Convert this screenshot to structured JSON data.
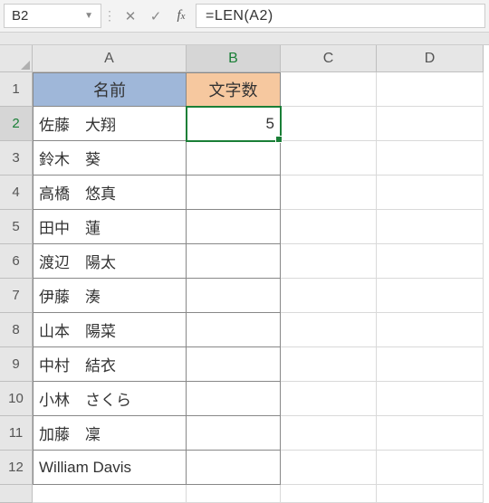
{
  "formula_bar": {
    "name_box": "B2",
    "formula": "=LEN(A2)"
  },
  "columns": [
    "A",
    "B",
    "C",
    "D"
  ],
  "rows": [
    "1",
    "2",
    "3",
    "4",
    "5",
    "6",
    "7",
    "8",
    "9",
    "10",
    "11",
    "12"
  ],
  "headers": {
    "a": "名前",
    "b": "文字数"
  },
  "data": {
    "a2": "佐藤　大翔",
    "b2": "5",
    "a3": "鈴木　葵",
    "a4": "高橋　悠真",
    "a5": "田中　蓮",
    "a6": "渡辺　陽太",
    "a7": "伊藤　湊",
    "a8": "山本　陽菜",
    "a9": "中村　結衣",
    "a10": "小林　さくら",
    "a11": "加藤　凜",
    "a12": "William Davis"
  }
}
